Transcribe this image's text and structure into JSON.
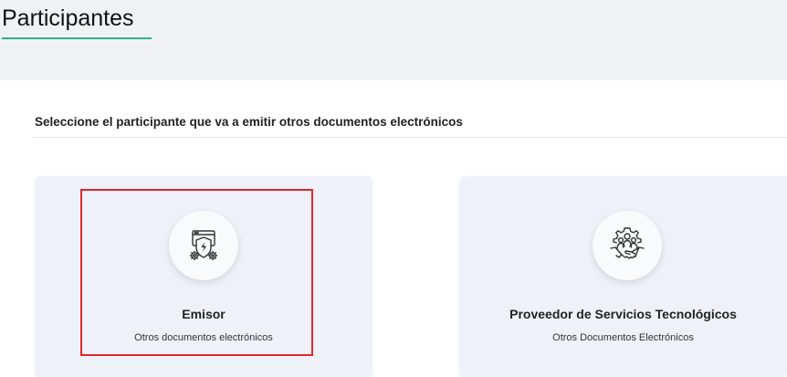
{
  "page": {
    "title": "Participantes",
    "instruction": "Seleccione el participante que va a emitir otros documentos electrónicos"
  },
  "participants": [
    {
      "title": "Emisor",
      "subtitle": "Otros documentos electrónicos",
      "icon": "emisor-shield-gear-icon"
    },
    {
      "title": "Proveedor de Servicios Tecnológicos",
      "subtitle": "Otros Documentos Electrónicos",
      "icon": "handshake-gear-icon"
    }
  ],
  "colors": {
    "accent": "#2bb38a",
    "highlight": "#e0262b",
    "card_bg": "#eef2f8",
    "header_bg": "#f0f1f2"
  }
}
